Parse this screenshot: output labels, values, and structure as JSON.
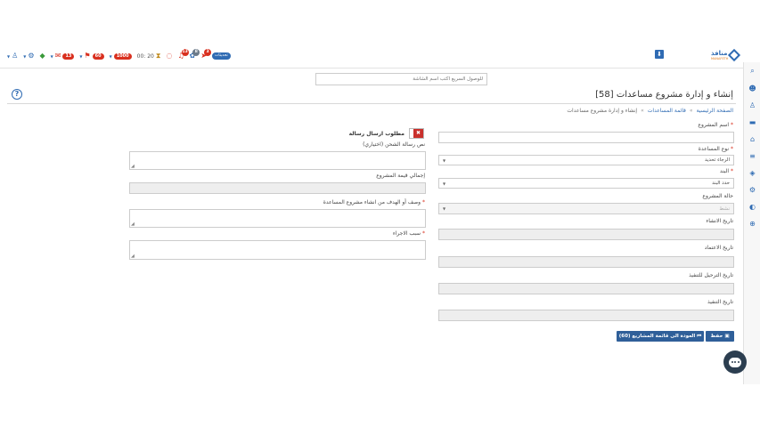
{
  "navbar": {
    "icons": {
      "user": "user-icon",
      "gear": "gear-icon",
      "wifi": "wifi-icon",
      "messages": "envelope-icon",
      "bell": "bell-icon",
      "globe": "globe-icon",
      "rocket": "rocket-icon",
      "chat": "chat-icon",
      "hourglass": "hourglass-icon",
      "cloud": "cloud-icon"
    },
    "badge_messages": "13",
    "badge_alerts": "60",
    "pill_1000": "1000",
    "timer": "00: 20",
    "badge_bell": "13",
    "badge_globe": "8",
    "badge_rocket": "3",
    "cloud_label": "تحديثات"
  },
  "logo": {
    "name": "منافذ",
    "sub": "MANAFETH"
  },
  "search": {
    "placeholder": "للوصول السريع اكتب اسم الشاشة"
  },
  "page": {
    "title": "إنشاء و إدارة مشروع مساعدات  [58]"
  },
  "breadcrumb": {
    "home": "الصفحة الرئيسية",
    "sep1": "»",
    "list": "قائمة المساعدات",
    "sep2": "»",
    "current": "إنشاء و إدارة مشروع مساعدات"
  },
  "form_right": {
    "project_name_label": "اسم المشروع",
    "aid_type_label": "نوع المساعدة",
    "aid_type_value": "الرجاء تحديد",
    "item_label": "البند",
    "item_value": "حدد البند",
    "status_label": "حالة المشروع",
    "status_value": "نشط",
    "created_label": "تاريخ الانشاء",
    "approved_label": "تاريخ الاعتماد",
    "scheduled_label": "تاريخ الترحيل للتنفيذ",
    "executed_label": "تاريخ التنفيذ",
    "required_mark": "*"
  },
  "form_left": {
    "send_message_label": "مطلوب ارسال رسالة",
    "toggle_mark": "✖",
    "sms_text_label": "نص رسالة الشحن (اختياري)",
    "total_value_label": "إجمالي قيمة المشروع",
    "description_label": "وصف أو الهدف من انشاء مشروع المساعدة",
    "reason_label": "سبب الاجراء"
  },
  "buttons": {
    "save": "حفظ",
    "back": "العودة الى قائمة المشاريع (60)"
  },
  "colors": {
    "primary": "#2f6bb3",
    "danger": "#d9301f",
    "button": "#2f5f99"
  }
}
